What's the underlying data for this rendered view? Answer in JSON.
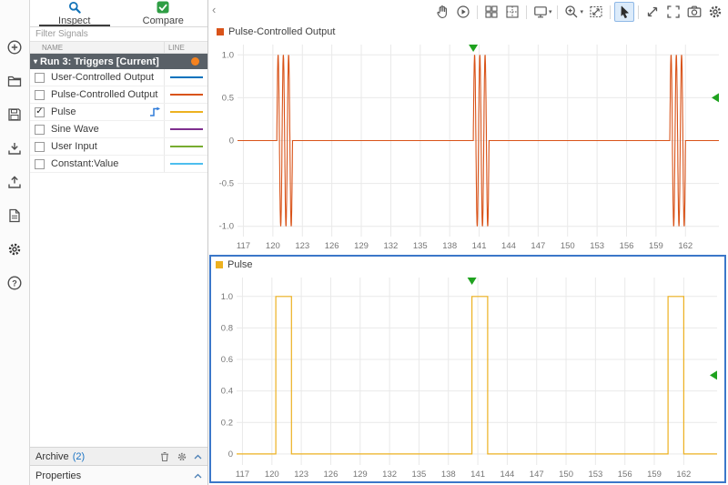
{
  "app_strip": {
    "icons": [
      "new",
      "open",
      "save",
      "import",
      "export",
      "create-report",
      "preferences",
      "help"
    ]
  },
  "sidebar": {
    "tabs": [
      {
        "label": "Inspect"
      },
      {
        "label": "Compare"
      }
    ],
    "filter_placeholder": "Filter Signals",
    "columns": [
      "NAME",
      "LINE"
    ],
    "run": {
      "label": "Run 3: Triggers [Current]",
      "status_color": "#f5821f"
    },
    "signals": [
      {
        "name": "User-Controlled Output",
        "checked": false,
        "color": "#0072BD",
        "trigger": false
      },
      {
        "name": "Pulse-Controlled Output",
        "checked": false,
        "color": "#D95319",
        "trigger": false
      },
      {
        "name": "Pulse",
        "checked": true,
        "color": "#EDB120",
        "trigger": true
      },
      {
        "name": "Sine Wave",
        "checked": false,
        "color": "#7E2F8E",
        "trigger": false
      },
      {
        "name": "User Input",
        "checked": false,
        "color": "#77AC30",
        "trigger": false
      },
      {
        "name": "Constant:Value",
        "checked": false,
        "color": "#4DBEEE",
        "trigger": false
      }
    ],
    "archive": {
      "label": "Archive",
      "count": "(2)"
    },
    "properties_label": "Properties"
  },
  "toolbar": {
    "icons": [
      "pan",
      "replay",
      "subplot-grid",
      "subplot-custom",
      "display-options",
      "zoom-in",
      "fit-to-view",
      "pointer",
      "expand",
      "fullscreen",
      "snapshot",
      "settings"
    ],
    "active_icon": "pointer"
  },
  "icons": {
    "run_caret": "▾",
    "dropdown_caret": "▾",
    "collapse_left": "‹"
  },
  "chart_data": [
    {
      "type": "line",
      "title": "Pulse-Controlled Output",
      "series_color": "#D95319",
      "line_width": 1.1,
      "grid": true,
      "legend_position": "top-left",
      "x_ticks": [
        117,
        120,
        123,
        126,
        129,
        132,
        135,
        138,
        141,
        144,
        147,
        150,
        153,
        156,
        159,
        162
      ],
      "y_ticks": [
        1.0,
        0.5,
        0,
        -0.5,
        -1.0
      ],
      "y_tick_labels": [
        "1.0",
        "0.5",
        "0",
        "-0.5",
        "-1.0"
      ],
      "x_range": [
        116.4,
        165.4
      ],
      "y_range": [
        -1.12,
        1.12
      ],
      "signal": {
        "kind": "gated_sine",
        "base": 0,
        "amplitude": 1.0,
        "cycles_per_window": 3,
        "windows": [
          [
            120.4,
            122.0
          ],
          [
            140.4,
            142.0
          ],
          [
            160.4,
            162.0
          ]
        ]
      },
      "trigger": {
        "time": 140.4,
        "level": 0.5,
        "color": "#1fa21f"
      }
    },
    {
      "type": "line",
      "title": "Pulse",
      "series_color": "#EDB120",
      "line_width": 1.2,
      "grid": true,
      "legend_position": "top-left",
      "x_ticks": [
        117,
        120,
        123,
        126,
        129,
        132,
        135,
        138,
        141,
        144,
        147,
        150,
        153,
        156,
        159,
        162
      ],
      "y_ticks": [
        1.0,
        0.8,
        0.6,
        0.4,
        0.2,
        0
      ],
      "y_tick_labels": [
        "1.0",
        "0.8",
        "0.6",
        "0.4",
        "0.2",
        "0"
      ],
      "x_range": [
        116.4,
        165.4
      ],
      "y_range": [
        -0.07,
        1.12
      ],
      "signal": {
        "kind": "pulse",
        "low": 0,
        "high": 1,
        "windows": [
          [
            120.4,
            122.0
          ],
          [
            140.4,
            142.0
          ],
          [
            160.4,
            162.0
          ]
        ]
      },
      "trigger": {
        "time": 140.4,
        "level": 0.5,
        "color": "#1fa21f"
      }
    }
  ]
}
